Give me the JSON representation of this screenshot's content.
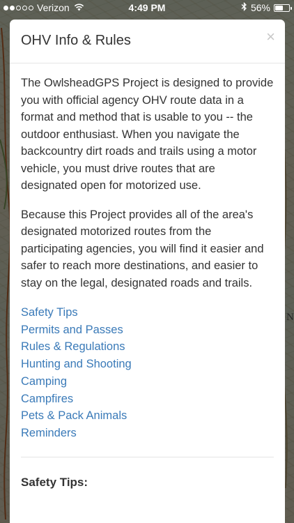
{
  "status_bar": {
    "carrier": "Verizon",
    "time": "4:49 PM",
    "battery": "56%",
    "battery_level": 0.56,
    "signal_bars_filled": 2,
    "signal_bars_total": 5
  },
  "map": {
    "edge_label": "NA"
  },
  "modal": {
    "title": "OHV Info & Rules",
    "close_label": "×",
    "paragraphs": [
      "The OwlsheadGPS Project is designed to provide you with official agency OHV route data in a format and method that is usable to you -- the outdoor enthusiast. When you navigate the backcountry dirt roads and trails using a motor vehicle, you must drive routes that are designated open for motorized use.",
      "Because this Project provides all of the area's designated motorized routes from the participating agencies, you will find it easier and safer to reach more destinations, and easier to stay on the legal, designated roads and trails."
    ],
    "links": [
      "Safety Tips",
      "Permits and Passes",
      "Rules & Regulations",
      "Hunting and Shooting",
      "Camping",
      "Campfires",
      "Pets & Pack Animals",
      "Reminders"
    ],
    "section_heading": "Safety Tips:"
  },
  "colors": {
    "link": "#3a7ab8",
    "text": "#333333",
    "close": "#c8c8c8",
    "overlay": "rgba(0,0,0,0.55)"
  },
  "icons": [
    "wifi-icon",
    "bluetooth-icon",
    "battery-icon",
    "close-icon"
  ]
}
